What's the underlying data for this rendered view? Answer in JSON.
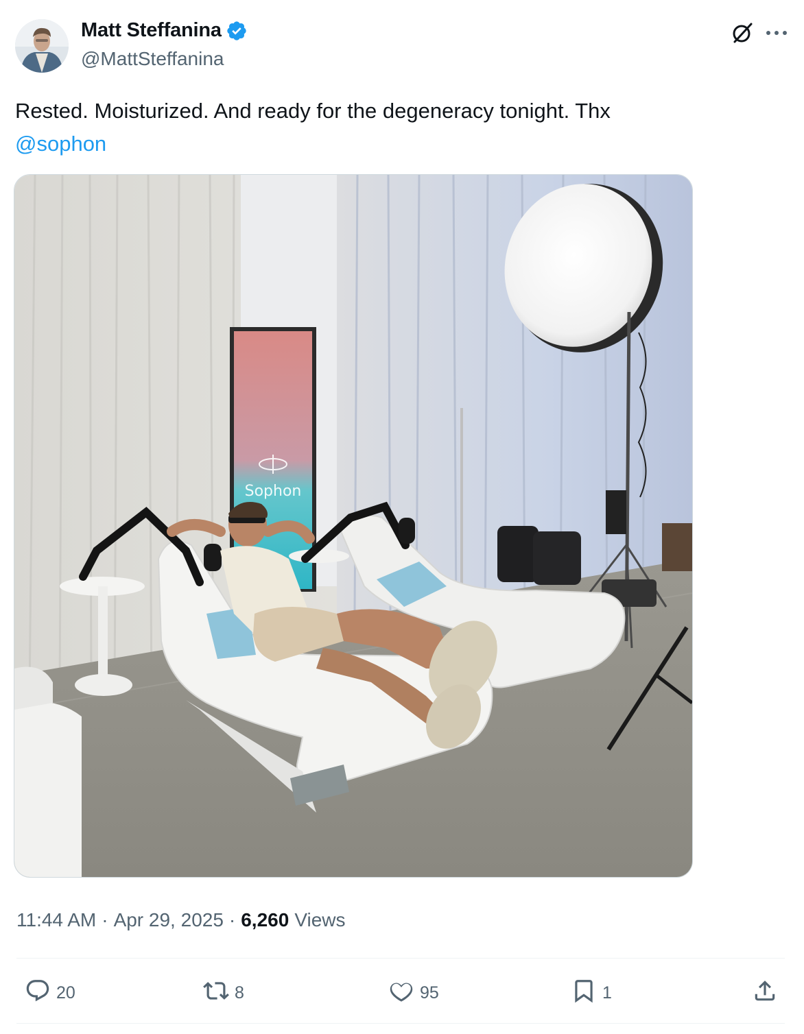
{
  "author": {
    "name": "Matt Steffanina",
    "handle": "@MattSteffanina",
    "verified": true
  },
  "tweet": {
    "text": "Rested. Moisturized. And ready for the degeneracy tonight.  Thx ",
    "mention": "@sophon",
    "image_text": "Sophon"
  },
  "meta": {
    "time": "11:44 AM",
    "separator1": "·",
    "date": "Apr 29, 2025",
    "separator2": "·",
    "views_count": "6,260",
    "views_label": "Views"
  },
  "actions": {
    "replies": "20",
    "reposts": "8",
    "likes": "95",
    "bookmarks": "1"
  },
  "colors": {
    "accent": "#1d9bf0",
    "secondary_text": "#536471",
    "primary_text": "#0f1419"
  },
  "icons": [
    "verified-badge-icon",
    "grok-icon",
    "more-icon",
    "reply-icon",
    "repost-icon",
    "like-icon",
    "bookmark-icon",
    "share-icon"
  ]
}
